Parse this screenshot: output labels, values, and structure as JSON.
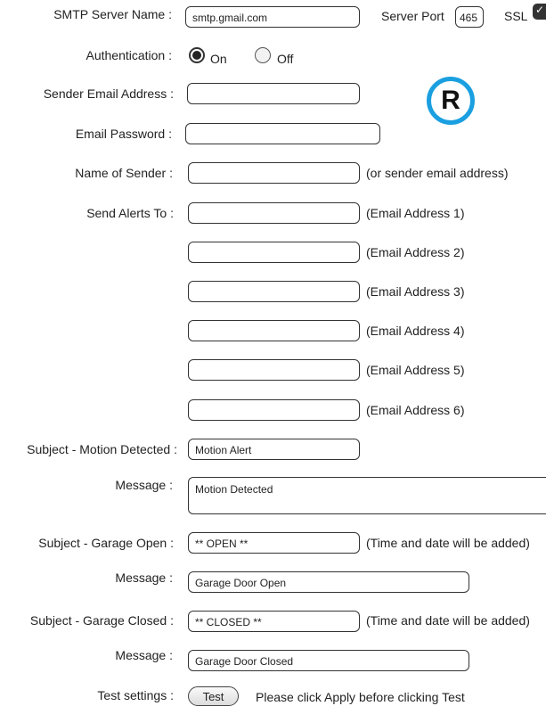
{
  "smtp": {
    "server_label": "SMTP Server Name :",
    "server_value": "smtp.gmail.com",
    "port_label": "Server Port",
    "port_value": "465",
    "ssl_label": "SSL",
    "ssl_checked": true
  },
  "auth": {
    "label": "Authentication :",
    "on_label": "On",
    "off_label": "Off",
    "selected": "On"
  },
  "sender_email": {
    "label": "Sender Email Address :",
    "value": ""
  },
  "password": {
    "label": "Email Password :",
    "value": ""
  },
  "sender_name": {
    "label": "Name of Sender :",
    "value": "",
    "hint": "(or sender email address)"
  },
  "alerts": {
    "label": "Send Alerts To :",
    "recipients": [
      {
        "hint": "(Email Address 1)",
        "value": ""
      },
      {
        "hint": "(Email Address 2)",
        "value": ""
      },
      {
        "hint": "(Email Address 3)",
        "value": ""
      },
      {
        "hint": "(Email Address 4)",
        "value": ""
      },
      {
        "hint": "(Email Address 5)",
        "value": ""
      },
      {
        "hint": "(Email Address 6)",
        "value": ""
      }
    ]
  },
  "motion": {
    "subject_label": "Subject - Motion Detected :",
    "subject_value": "Motion Alert",
    "message_label": "Message :",
    "message_value": "Motion Detected"
  },
  "garage_open": {
    "subject_label": "Subject - Garage Open :",
    "subject_value": "** OPEN **",
    "hint": "(Time and date will be added)",
    "message_label": "Message :",
    "message_value": "Garage Door Open"
  },
  "garage_closed": {
    "subject_label": "Subject - Garage Closed :",
    "subject_value": "** CLOSED **",
    "hint": "(Time and date will be added)",
    "message_label": "Message :",
    "message_value": "Garage Door Closed"
  },
  "test": {
    "label": "Test settings :",
    "button_label": "Test",
    "note": "Please click Apply before clicking Test"
  },
  "logo": {
    "letter": "R",
    "ring_color": "#1a9fe0"
  }
}
